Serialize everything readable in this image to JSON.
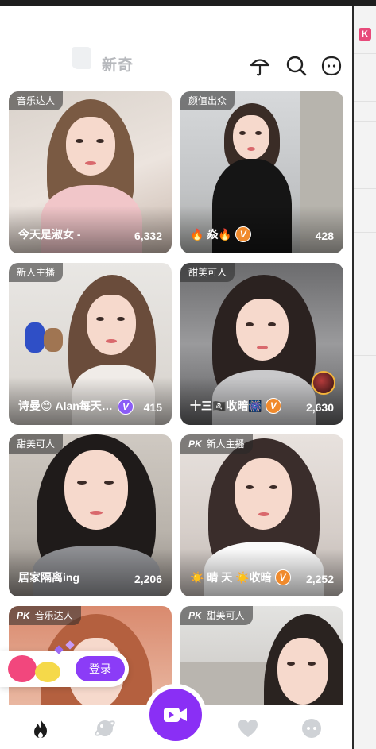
{
  "header": {
    "active_tab": "新奇",
    "icons": [
      "umbrella-icon",
      "search-icon",
      "chat-bubble-icon"
    ]
  },
  "cards": [
    {
      "tag": "音乐达人",
      "pk": "",
      "name": "今天是淑女 -",
      "count": "6,332",
      "badge": ""
    },
    {
      "tag": "颜值出众",
      "pk": "",
      "name": "🔥 焱🔥",
      "count": "428",
      "badge": "V"
    },
    {
      "tag": "新人主播",
      "pk": "",
      "name": "诗曼😊 Alan每天…",
      "count": "415",
      "badge": "V"
    },
    {
      "tag": "甜美可人",
      "pk": "",
      "name": "十三🏴‍☠️收暗🎆",
      "count": "2,630",
      "badge": "V"
    },
    {
      "tag": "甜美可人",
      "pk": "",
      "name": "居家隔离ing",
      "count": "2,206",
      "badge": ""
    },
    {
      "tag": "新人主播",
      "pk": "PK",
      "name": "☀️ 晴 天 ☀️收暗",
      "count": "2,252",
      "badge": "V"
    },
    {
      "tag": "音乐达人",
      "pk": "PK",
      "name": "",
      "count": "",
      "badge": ""
    },
    {
      "tag": "甜美可人",
      "pk": "PK",
      "name": "",
      "count": "",
      "badge": ""
    }
  ],
  "login": {
    "label": "登录"
  },
  "bottom_nav": [
    "fire-icon",
    "planet-icon",
    "camera-icon",
    "heart-icon",
    "face-icon"
  ],
  "colors": {
    "accent": "#8a2ff5",
    "badge_orange": "#f08a2c",
    "badge_purple": "#8b5cf6"
  }
}
